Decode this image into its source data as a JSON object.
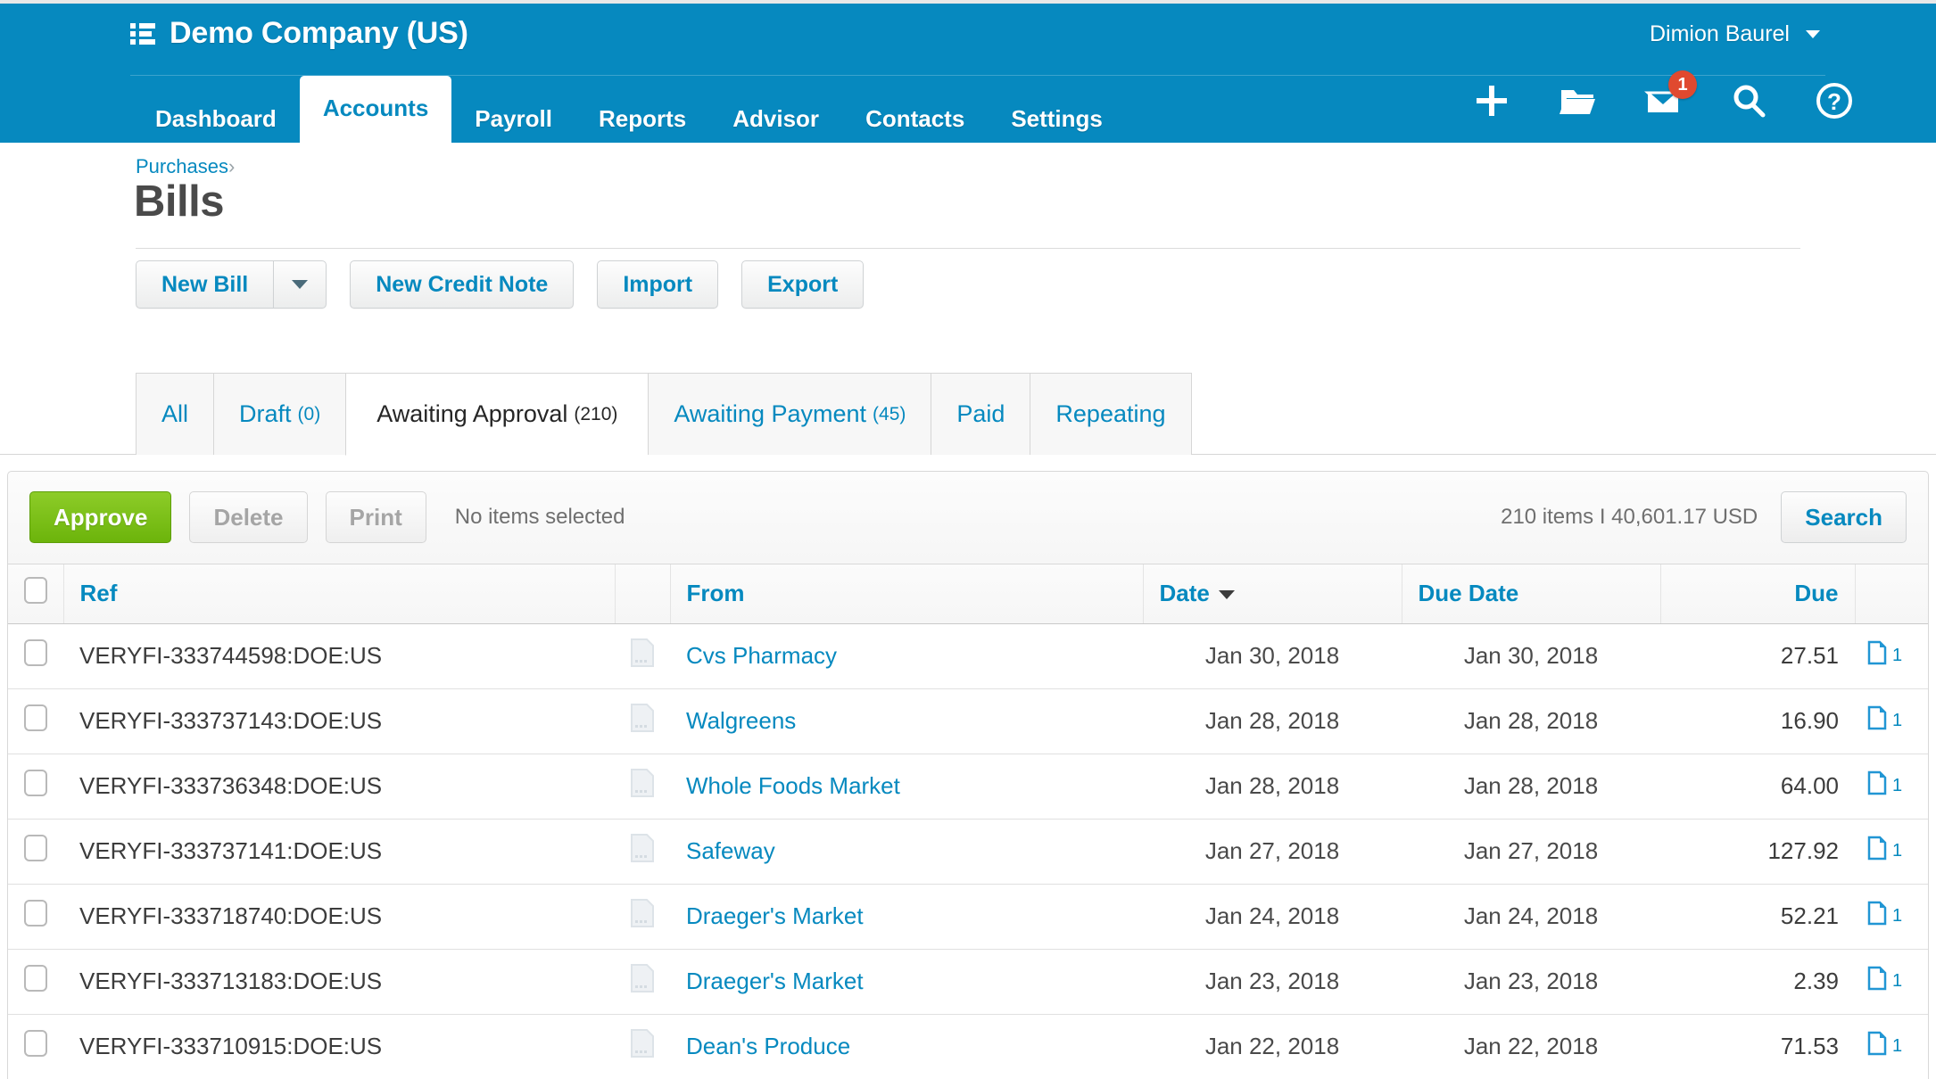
{
  "header": {
    "company": "Demo Company (US)",
    "user": "Dimion Baurel",
    "nav": [
      {
        "label": "Dashboard",
        "active": false
      },
      {
        "label": "Accounts",
        "active": true
      },
      {
        "label": "Payroll",
        "active": false
      },
      {
        "label": "Reports",
        "active": false
      },
      {
        "label": "Advisor",
        "active": false
      },
      {
        "label": "Contacts",
        "active": false
      },
      {
        "label": "Settings",
        "active": false
      }
    ],
    "icons": [
      "plus-icon",
      "folder-icon",
      "envelope-icon",
      "search-icon",
      "help-icon"
    ],
    "message_badge": "1",
    "accent_color": "#0689bf"
  },
  "page": {
    "breadcrumb": "Purchases",
    "breadcrumb_separator": "›",
    "title": "Bills"
  },
  "actions": {
    "new_bill": "New Bill",
    "new_credit_note": "New Credit Note",
    "import": "Import",
    "export": "Export"
  },
  "subtabs": [
    {
      "label": "All",
      "count": "",
      "active": false
    },
    {
      "label": "Draft",
      "count": "(0)",
      "active": false
    },
    {
      "label": "Awaiting Approval",
      "count": "(210)",
      "active": true
    },
    {
      "label": "Awaiting Payment",
      "count": "(45)",
      "active": false
    },
    {
      "label": "Paid",
      "count": "",
      "active": false
    },
    {
      "label": "Repeating",
      "count": "",
      "active": false
    }
  ],
  "toolbar": {
    "approve": "Approve",
    "delete": "Delete",
    "print": "Print",
    "selection_status": "No items selected",
    "summary": "210 items I 40,601.17 USD",
    "search": "Search",
    "approve_color": "#6cb40b"
  },
  "table": {
    "columns": [
      "Ref",
      "From",
      "Date",
      "Due Date",
      "Due"
    ],
    "sorted_column": "Date",
    "rows": [
      {
        "ref": "VERYFI-333744598:DOE:US",
        "from": "Cvs Pharmacy",
        "date": "Jan 30, 2018",
        "due_date": "Jan 30, 2018",
        "due": "27.51",
        "attachments": "1"
      },
      {
        "ref": "VERYFI-333737143:DOE:US",
        "from": "Walgreens",
        "date": "Jan 28, 2018",
        "due_date": "Jan 28, 2018",
        "due": "16.90",
        "attachments": "1"
      },
      {
        "ref": "VERYFI-333736348:DOE:US",
        "from": "Whole Foods Market",
        "date": "Jan 28, 2018",
        "due_date": "Jan 28, 2018",
        "due": "64.00",
        "attachments": "1"
      },
      {
        "ref": "VERYFI-333737141:DOE:US",
        "from": "Safeway",
        "date": "Jan 27, 2018",
        "due_date": "Jan 27, 2018",
        "due": "127.92",
        "attachments": "1"
      },
      {
        "ref": "VERYFI-333718740:DOE:US",
        "from": "Draeger's Market",
        "date": "Jan 24, 2018",
        "due_date": "Jan 24, 2018",
        "due": "52.21",
        "attachments": "1"
      },
      {
        "ref": "VERYFI-333713183:DOE:US",
        "from": "Draeger's Market",
        "date": "Jan 23, 2018",
        "due_date": "Jan 23, 2018",
        "due": "2.39",
        "attachments": "1"
      },
      {
        "ref": "VERYFI-333710915:DOE:US",
        "from": "Dean's Produce",
        "date": "Jan 22, 2018",
        "due_date": "Jan 22, 2018",
        "due": "71.53",
        "attachments": "1"
      }
    ]
  }
}
